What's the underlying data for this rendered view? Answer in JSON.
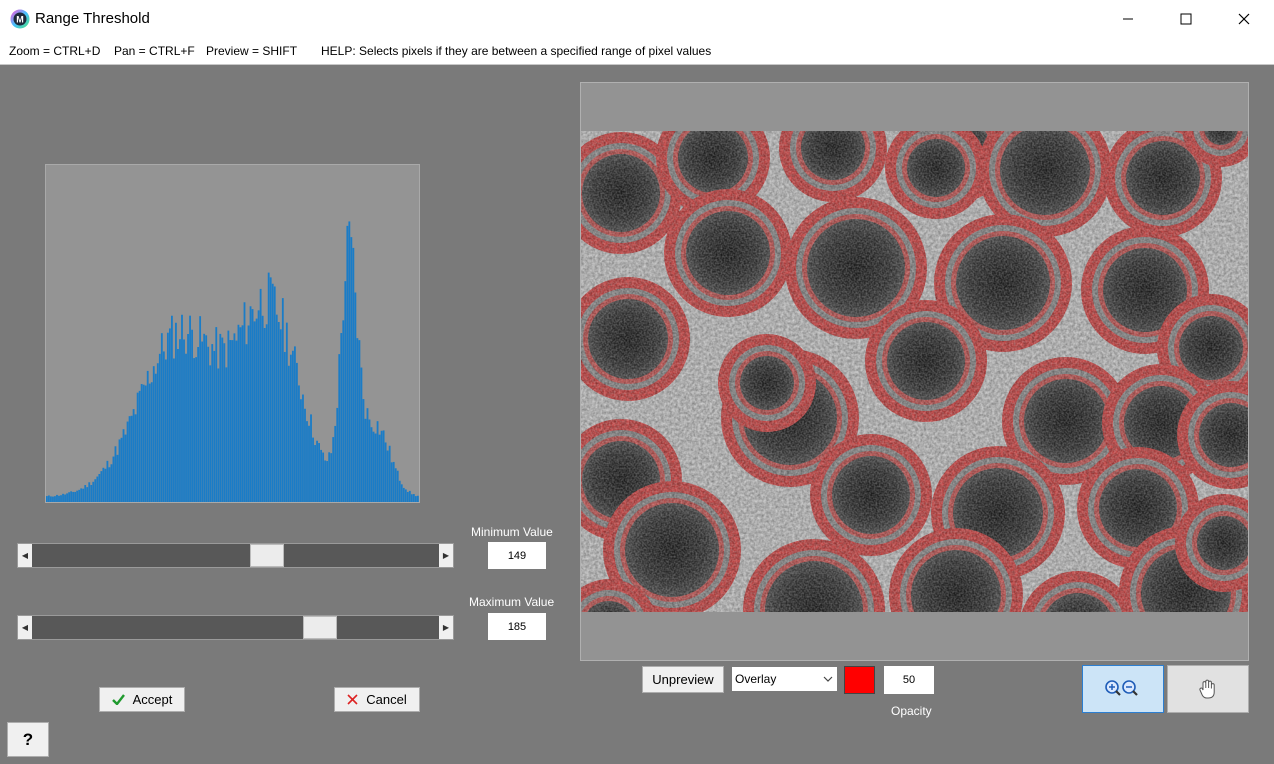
{
  "window": {
    "title": "Range Threshold",
    "icon_letter": "M"
  },
  "help": {
    "zoom": "Zoom = CTRL+D",
    "pan": "Pan = CTRL+F",
    "preview": "Preview = SHIFT",
    "help_text": "HELP:  Selects pixels if they are between a specified range of pixel values"
  },
  "thresholds": {
    "min_label": "Minimum Value",
    "min_value": "149",
    "max_label": "Maximum Value",
    "max_value": "185",
    "range_max": 255
  },
  "buttons": {
    "accept": "Accept",
    "cancel": "Cancel",
    "help": "?",
    "unpreview": "Unpreview"
  },
  "overlay": {
    "mode": "Overlay",
    "color": "#ff0000",
    "opacity": "50",
    "opacity_label": "Opacity"
  },
  "colors": {
    "histogram_bar": "#1a7cc7",
    "overlay_red": "#d9504f"
  }
}
